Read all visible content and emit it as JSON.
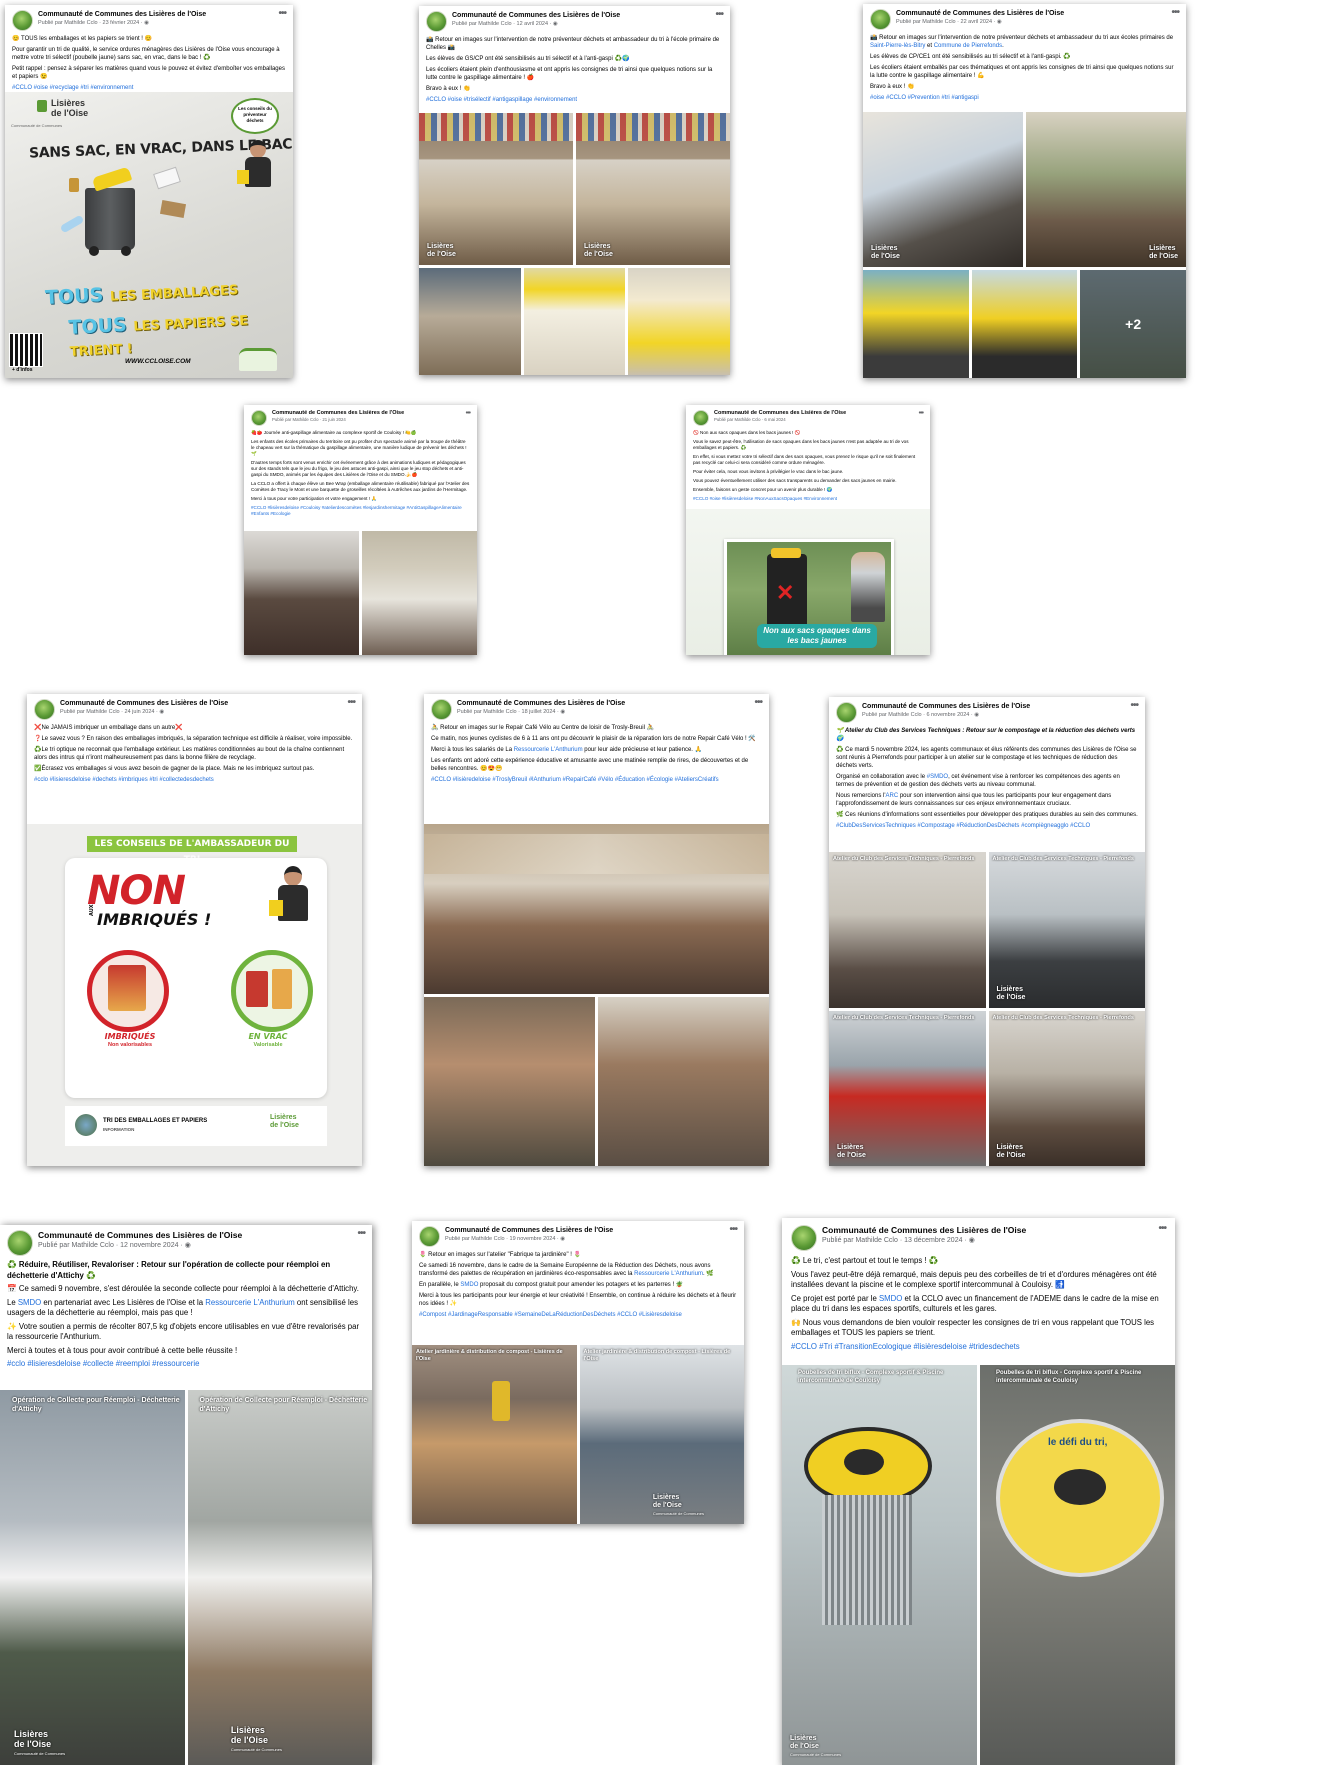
{
  "page_name": "Communauté de Communes des Lisières de l'Oise",
  "published_by": "Publié par Mathilde Cclo",
  "menu_glyph": "•••",
  "colors": {
    "hashtag": "#216fdb",
    "brand_green": "#5b9a35",
    "background": "#ffffff"
  },
  "posts": [
    {
      "date": "23 février 2024",
      "lines": [
        "😊 TOUS les emballages et les papiers se trient ! 😊",
        "Pour garantir un tri de qualité, le service ordures ménagères des Lisières de l'Oise vous encourage à mettre votre tri sélectif (poubelle jaune) sans sac, en vrac, dans le bac ! ♻️",
        "Petit rappel : pensez à séparer les matières quand vous le pouvez et évitez d'emboîter vos emballages et papiers 😉"
      ],
      "tags": "#CCLO #oise #recyclage #tri #environnement",
      "poster": {
        "logo_line1": "Lisières",
        "logo_line2": "de l'Oise",
        "logo_sub": "Communauté de Communes",
        "bubble": "Les conseils du préventeur déchets",
        "headline": "SANS SAC, EN VRAC, DANS LE BAC",
        "tous1": "TOUS",
        "rest1": "LES EMBALLAGES",
        "tous2": "TOUS",
        "rest2": "LES PAPIERS SE TRIENT !",
        "qr_label": "+ d'infos",
        "url": "WWW.CCLOISE.COM"
      }
    },
    {
      "date": "12 avril 2024",
      "lines": [
        "📸 Retour en images sur l'intervention de notre préventeur déchets et ambassadeur du tri à l'école primaire de Chelles 📸",
        "Les élèves de GS/CP ont été sensibilisés au tri sélectif et à l'anti-gaspi ♻️🌍",
        "Les écoliers étaient plein d'enthousiasme et ont appris les consignes de tri ainsi que quelques notions sur la lutte contre le gaspillage alimentaire ! 🍎",
        "Bravo à eux ! 👏"
      ],
      "tags": "#CCLO #oise #trisélectif #antigaspillage #environnement"
    },
    {
      "date": "22 avril 2024",
      "line1_pre": "📸 Retour en images sur l'intervention de notre préventeur déchets et ambassadeur du tri aux écoles primaires de ",
      "link1": "Saint-Pierre-lès-Bitry",
      "mid": " et ",
      "link2": "Commune de Pierrefonds",
      "line1_post": ".",
      "lines": [
        "Les élèves de CP/CE1 ont été sensibilisés au tri sélectif et à l'anti-gaspi. ♻️",
        "Les écoliers étaient emballés par ces thématiques et ont appris les consignes de tri ainsi que quelques notions sur la lutte contre le gaspillage alimentaire ! 💪",
        "Bravo à eux ! 👏"
      ],
      "tags": "#oise #CCLO #Prevention #tri #antigaspi",
      "more": "+2"
    },
    {
      "date": "21 juin 2024",
      "lines": [
        "🍓🍅 Journée anti-gaspillage alimentaire au complexe sportif de Couloisy ! 🍋🍏",
        "Les enfants des écoles primaires du territoire ont pu profiter d'un spectacle animé par la troupe de théâtre le chapeau vert sur la thématique du gaspillage alimentaire, une manière ludique de prévenir les déchets ! 🌱",
        "D'autres temps forts sont venus enrichir cet événement grâce à des animations ludiques et pédagogiques sur des stands tels que le jeu du frigo, le jeu des astuces anti-gaspi, ainsi que le jeu stop déchets et anti-gaspi du SMDO, animés par les équipes des Lisières de l'Oise et du SMDO.🍌🍎",
        "La CCLO a offert à chaque élève un Bee Wrap (emballage alimentaire réutilisable) fabriqué par l'Atelier des Comètes de Tracy le Mont et une barquette de groseilles récoltées à Autrêches aux jardins de l'Hermitage.",
        "Merci à tous pour votre participation et votre engagement ! 🙏"
      ],
      "tags": "#CCLO #lisièresdeloise #Couloisy #atelierdescomètes #lesjardinshermitage #AntiGaspillageAlimentaire #Enfants #Ecologie"
    },
    {
      "date": "6 mai 2024",
      "lines": [
        "🚫 Non aux sacs opaques dans les bacs jaunes ! 🚫",
        "Vous le savez peut-être, l'utilisation de sacs opaques dans les bacs jaunes n'est pas adaptée au tri de vos emballages et papiers. ♻️",
        "En effet, si vous mettez votre tri sélectif dans des sacs opaques, vous prenez le risque qu'il ne soit finalement pas recyclé car celui-ci sera considéré comme ordure ménagère.",
        "Pour éviter cela, nous vous invitons à privilégier le vrac dans le bac jaune.",
        "Vous pouvez éventuellement utiliser des sacs transparents ou demander des sacs jaunes en mairie.",
        "Ensemble, faisons un geste concret pour un avenir plus durable ! 🌍"
      ],
      "tags": "#CCLO #oise #lisièresdeloise #NonAuxSacsOpaques #Environnement",
      "banner": "Non aux sacs opaques dans les bacs jaunes"
    },
    {
      "date": "24 juin 2024",
      "lines": [
        "❌Ne JAMAIS imbriquer un emballage dans un autre❌",
        "❓Le savez vous ? En raison des emballages imbriqués, la séparation technique est difficile à réaliser, voire impossible.",
        "♻️Le tri optique ne reconnait que l'emballage extérieur. Les matières conditionnées au bout de la chaîne contiennent alors des intrus qui n'iront malheureusement pas dans la bonne filière de recyclage.",
        "✅Écrasez vos emballages si vous avez besoin de gagner de la place. Mais ne les imbriquez surtout pas."
      ],
      "tags": "#cclo #lisieresdeloise #dechets #imbriques #tri #collectedesdechets",
      "poster": {
        "banner": "LES CONSEILS DE L'AMBASSADEUR DU TRI",
        "non": "NON",
        "aux": "AUX",
        "imbriques": "IMBRIQUÉS !",
        "left_title": "IMBRIQUÉS",
        "left_sub": "Non valorisables",
        "right_title": "EN VRAC",
        "right_sub": "Valorisable",
        "footer_title": "TRI DES EMBALLAGES ET PAPIERS",
        "footer_sub": "INFORMATION",
        "logo1": "Lisières",
        "logo2": "de l'Oise"
      }
    },
    {
      "date": "18 juillet 2024",
      "lines": [
        "🚴 Retour en images sur le Repair Café Vélo au Centre de loisir de Trosly-Breuil 🚴"
      ],
      "p2": "Ce matin, nos jeunes cyclistes de 6 à 11 ans ont pu découvrir le plaisir de la réparation lors de notre Repair Café Vélo ! 🛠️",
      "p3_pre": "Merci à tous les salariés de La ",
      "p3_link": "Ressourcerie L'Anthurium",
      "p3_post": " pour leur aide précieuse et leur patience. 🙏",
      "p4": "Les enfants ont adoré cette expérience éducative et amusante avec une matinée remplie de rires, de découvertes et de belles rencontres. 😊😍😁",
      "tags": "#CCLO #lisièredeloise #TroslyBreuil #lAnthurium #RepairCafé #Vélo #Éducation #Écologie #AteliersCréatifs"
    },
    {
      "date": "6 novembre 2024",
      "title": "🌱 Atelier du Club des Services Techniques : Retour sur le compostage et la réduction des déchets verts 🌍",
      "p1": "♻️ Ce mardi 5 novembre 2024, les agents communaux et élus référents des communes des Lisières de l'Oise se sont réunis à Pierrefonds pour participer à un atelier sur le compostage et les techniques de réduction des déchets verts.",
      "p2_pre": "Organisé en collaboration avec le ",
      "p2_link": "#SMDO",
      "p2_post": ", cet événement vise à renforcer les compétences des agents en termes de prévention et de gestion des déchets verts au niveau communal.",
      "p3_pre": "Nous remercions l'",
      "p3_link": "ARC",
      "p3_post": " pour son intervention ainsi que tous les participants pour leur engagement dans l'approfondissement de leurs connaissances sur ces enjeux environnementaux cruciaux.",
      "p4": "🌿 Ces réunions d'informations sont essentielles pour développer des pratiques durables au sein des communes.",
      "tags": "#ClubDesServicesTechniques #Compostage #RéductionDesDéchets #compiègneagglo #CCLO",
      "caption1": "Atelier du Club des Services Techniques - Pierrefonds",
      "caption2": "Atelier du Club des Services Techniques - Pierrefonds"
    },
    {
      "date": "12 novembre 2024",
      "title": "♻️ Réduire, Réutiliser, Revaloriser : Retour sur l'opération de collecte pour réemploi en déchetterie d'Attichy ♻️",
      "p1": "📅 Ce samedi 9 novembre, s'est déroulée la seconde collecte pour réemploi à la déchetterie d'Attichy.",
      "p2_pre": "Le ",
      "p2_link1": "SMDO",
      "p2_mid": " en partenariat avec Les Lisières de l'Oise et la ",
      "p2_link2": "Ressourcerie L'Anthurium",
      "p2_post": " ont sensibilisé les usagers de la déchetterie au réemploi, mais pas que !",
      "p3": "✨ Votre soutien a permis de récolter 807,5 kg d'objets encore utilisables en vue d'être revalorisés par la ressourcerie l'Anthurium.",
      "p4": "Merci à toutes et à tous pour avoir contribué à cette belle réussite !",
      "tags": "#cclo #lisieresdeloise #collecte #reemploi #ressourcerie",
      "caption1": "Opération de Collecte pour Réemploi - Déchetterie d'Attichy",
      "caption2": "Opération de Collecte pour Réemploi - Déchetterie d'Attichy"
    },
    {
      "date": "19 novembre 2024",
      "title": "🌷 Retour en images sur l'atelier \"Fabrique ta jardinière\" ! 🌷",
      "p1_pre": "Ce samedi 16 novembre, dans le cadre de la Semaine Européenne de la Réduction des Déchets, nous avons transformé des palettes de récupération en jardinières éco-responsables avec la ",
      "p1_link": "Ressourcerie L'Anthurium",
      "p1_post": ". 🌿",
      "p2_pre": "En parallèle, le ",
      "p2_link": "SMDO",
      "p2_post": " proposait du compost gratuit pour amender les potagers et les parterres ! 🪴",
      "p3": "Merci à tous les participants pour leur énergie et leur créativité ! Ensemble, on continue à réduire les déchets et à fleurir nos idées ! ✨",
      "tags": "#Compost #JardinageResponsable #SemaineDeLaRéductionDesDéchets #CCLO #Lisièresdeloise",
      "caption1": "Atelier jardinière & distribution de compost - Lisières de l'Oise",
      "caption2": "Atelier jardinière & distribution de compost - Lisières de l'Oise"
    },
    {
      "date": "13 décembre 2024",
      "title": "♻️ Le tri, c'est partout et tout le temps ! ♻️",
      "p1": "Vous l'avez peut-être déjà remarqué, mais depuis peu des corbeilles de tri et d'ordures ménagères ont été installées devant la piscine et le complexe sportif intercommunal à Couloisy. 🚮",
      "p2_pre": "Ce projet est porté par le ",
      "p2_link": "SMDO",
      "p2_post": " et la CCLO avec un financement de l'ADEME dans le cadre de la mise en place du tri dans les espaces sportifs, culturels et les gares.",
      "p3": "🙌 Nous vous demandons de bien vouloir respecter les consignes de tri en vous rappelant que TOUS les emballages et TOUS les papiers se trient.",
      "tags": "#CCLO #Tri #TransitionEcologique #lisièresdeloise #tridesdechets",
      "caption1": "Poubelles de tri biflux - Complexe sportif & Piscine intercommunale de Couloisy",
      "caption2": "Poubelles de tri biflux - Complexe sportif & Piscine intercommunale de Couloisy",
      "sticker": "le défi du tri,"
    }
  ],
  "watermark": {
    "line1": "Lisières",
    "line2": "de l'Oise",
    "sub": "Communauté de Communes"
  }
}
